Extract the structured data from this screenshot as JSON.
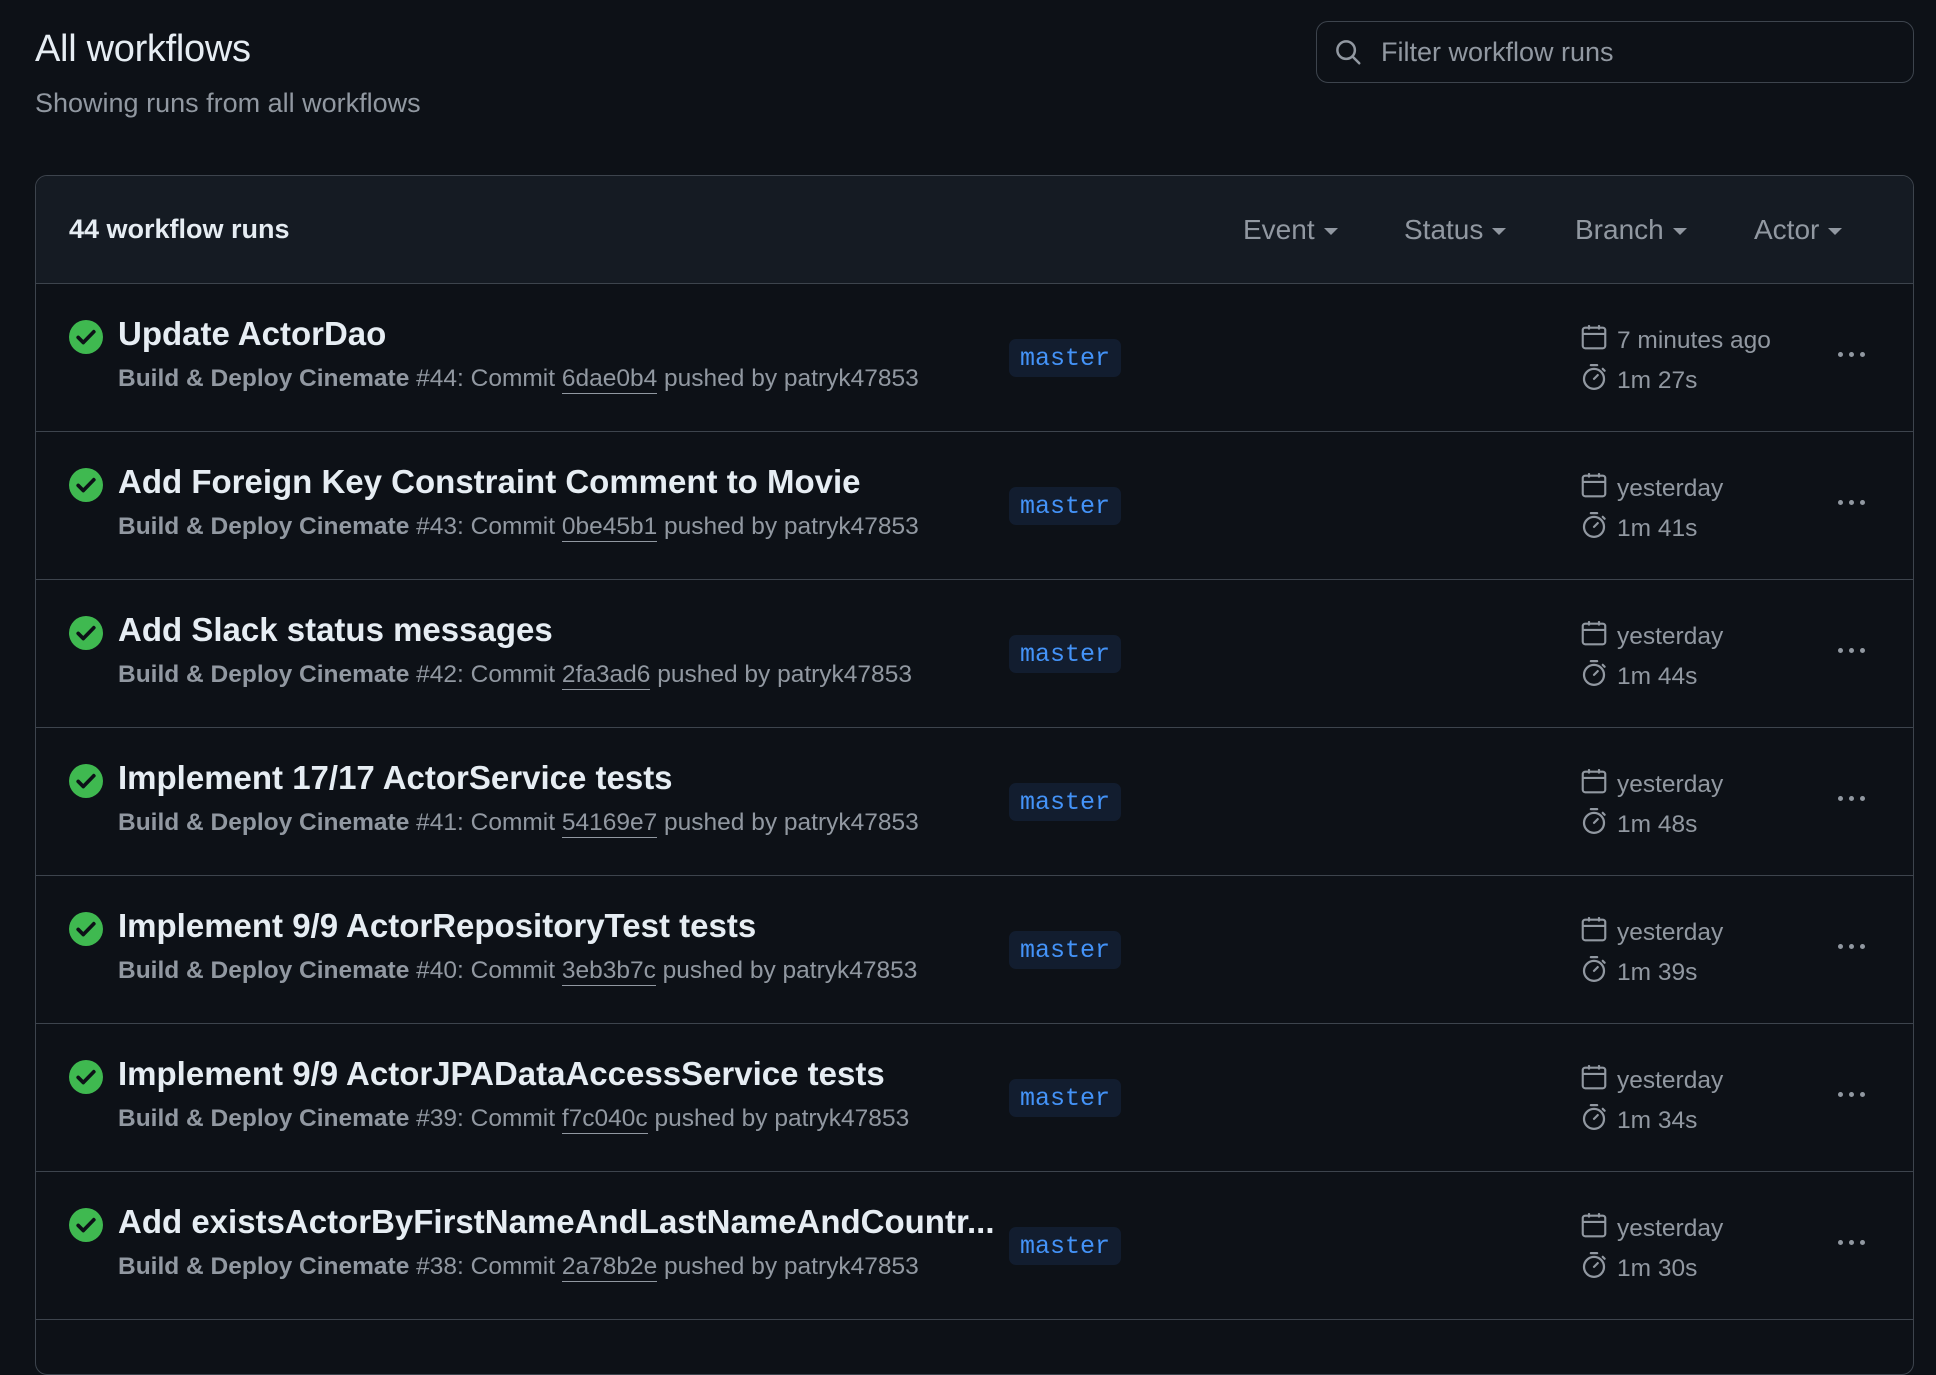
{
  "header": {
    "title": "All workflows",
    "subtitle": "Showing runs from all workflows"
  },
  "search": {
    "placeholder": "Filter workflow runs",
    "icon": "search-icon"
  },
  "list": {
    "count_label": "44 workflow runs",
    "filters": [
      "Event",
      "Status",
      "Branch",
      "Actor"
    ]
  },
  "runs": [
    {
      "title": "Update ActorDao",
      "workflow": "Build & Deploy Cinemate",
      "number": "#44",
      "commit": "6dae0b4",
      "actor": "patryk47853",
      "branch": "master",
      "when": "7 minutes ago",
      "duration": "1m 27s",
      "status": "success"
    },
    {
      "title": "Add Foreign Key Constraint Comment to Movie",
      "workflow": "Build & Deploy Cinemate",
      "number": "#43",
      "commit": "0be45b1",
      "actor": "patryk47853",
      "branch": "master",
      "when": "yesterday",
      "duration": "1m 41s",
      "status": "success"
    },
    {
      "title": "Add Slack status messages",
      "workflow": "Build & Deploy Cinemate",
      "number": "#42",
      "commit": "2fa3ad6",
      "actor": "patryk47853",
      "branch": "master",
      "when": "yesterday",
      "duration": "1m 44s",
      "status": "success"
    },
    {
      "title": "Implement 17/17 ActorService tests",
      "workflow": "Build & Deploy Cinemate",
      "number": "#41",
      "commit": "54169e7",
      "actor": "patryk47853",
      "branch": "master",
      "when": "yesterday",
      "duration": "1m 48s",
      "status": "success"
    },
    {
      "title": "Implement 9/9 ActorRepositoryTest tests",
      "workflow": "Build & Deploy Cinemate",
      "number": "#40",
      "commit": "3eb3b7c",
      "actor": "patryk47853",
      "branch": "master",
      "when": "yesterday",
      "duration": "1m 39s",
      "status": "success"
    },
    {
      "title": "Implement 9/9 ActorJPADataAccessService tests",
      "workflow": "Build & Deploy Cinemate",
      "number": "#39",
      "commit": "f7c040c",
      "actor": "patryk47853",
      "branch": "master",
      "when": "yesterday",
      "duration": "1m 34s",
      "status": "success"
    },
    {
      "title": "Add existsActorByFirstNameAndLastNameAndCountr...",
      "workflow": "Build & Deploy Cinemate",
      "number": "#38",
      "commit": "2a78b2e",
      "actor": "patryk47853",
      "branch": "master",
      "when": "yesterday",
      "duration": "1m 30s",
      "status": "success"
    }
  ],
  "text": {
    "commit_prefix": ": Commit ",
    "pushed_by": " pushed by "
  },
  "colors": {
    "background": "#0d1117",
    "success": "#3fb950",
    "branch_text": "#4493f8",
    "muted": "#9198a1"
  }
}
